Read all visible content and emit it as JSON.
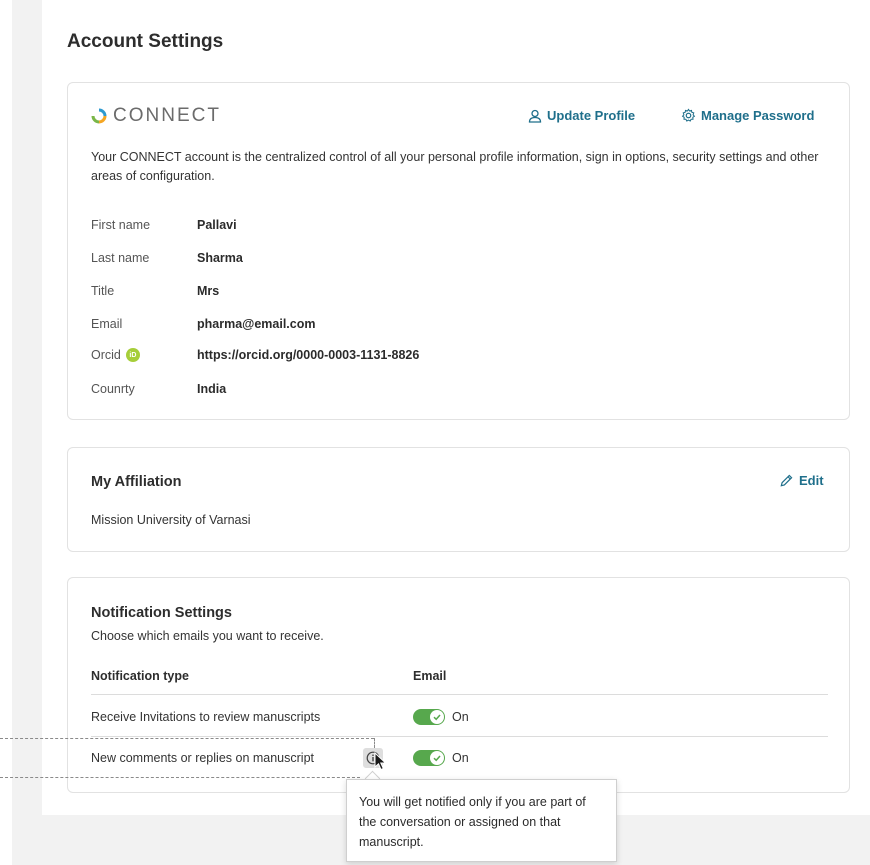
{
  "page_title": "Account Settings",
  "connect": {
    "brand_name": "CONNECT",
    "update_profile_label": "Update Profile",
    "manage_password_label": "Manage Password",
    "intro": "Your CONNECT account is the centralized control of all your personal profile information, sign in options, security settings and other areas of configuration.",
    "fields": [
      {
        "label": "First name",
        "value": "Pallavi"
      },
      {
        "label": "Last name",
        "value": "Sharma"
      },
      {
        "label": "Title",
        "value": "Mrs"
      },
      {
        "label": "Email",
        "value": "pharma@email.com"
      },
      {
        "label": "Orcid",
        "value": "https://orcid.org/0000-0003-1131-8826",
        "badge": "iD"
      },
      {
        "label": "Counrty",
        "value": "India"
      }
    ]
  },
  "affiliation": {
    "title": "My Affiliation",
    "edit_label": "Edit",
    "name": "Mission University of Varnasi"
  },
  "notifications": {
    "title": "Notification Settings",
    "subtitle": "Choose which emails you want to receive.",
    "col_type": "Notification type",
    "col_email": "Email",
    "rows": [
      {
        "label": "Receive Invitations to review manuscripts",
        "state": "On"
      },
      {
        "label": "New comments or replies on manuscript",
        "state": "On"
      }
    ],
    "tooltip": "You will get notified only if you are part of the conversation or assigned on that manuscript."
  },
  "colors": {
    "accent": "#1f6f8b",
    "toggle_on": "#57a84d",
    "orcid": "#a6ce39"
  }
}
